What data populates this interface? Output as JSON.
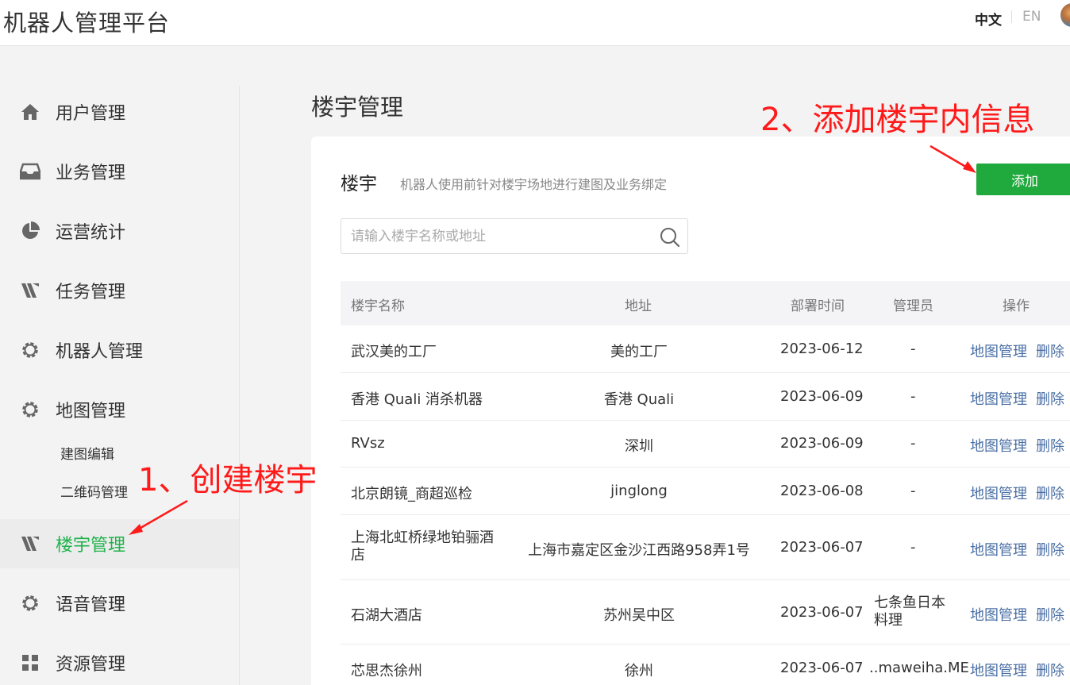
{
  "header": {
    "title": "机器人管理平台",
    "lang_zh": "中文",
    "lang_en": "EN"
  },
  "sidebar": {
    "items": [
      {
        "label": "用户管理",
        "icon": "home-icon"
      },
      {
        "label": "业务管理",
        "icon": "inbox-icon"
      },
      {
        "label": "运营统计",
        "icon": "pie-chart-icon"
      },
      {
        "label": "任务管理",
        "icon": "task-icon"
      },
      {
        "label": "机器人管理",
        "icon": "gear-icon"
      },
      {
        "label": "地图管理",
        "icon": "gear-icon"
      },
      {
        "label": "楼宇管理",
        "icon": "building-icon"
      },
      {
        "label": "语音管理",
        "icon": "gear-icon"
      },
      {
        "label": "资源管理",
        "icon": "grid-icon"
      }
    ],
    "subitems": [
      "建图编辑",
      "二维码管理"
    ],
    "active_color": "#20b24a"
  },
  "main": {
    "page_title": "楼宇管理",
    "card_title": "楼宇",
    "card_desc": "机器人使用前针对楼宇场地进行建图及业务绑定",
    "add_label": "添加",
    "search_placeholder": "请输入楼宇名称或地址",
    "columns": [
      "楼宇名称",
      "地址",
      "部署时间",
      "管理员",
      "操作"
    ],
    "rows": [
      {
        "name": "武汉美的工厂",
        "address": "美的工厂",
        "date": "2023-06-12",
        "admin": "-",
        "map": "地图管理",
        "del": "删除"
      },
      {
        "name": "香港 Quali 消杀机器",
        "address": "香港 Quali",
        "date": "2023-06-09",
        "admin": "-",
        "map": "地图管理",
        "del": "删除"
      },
      {
        "name": "RVsz",
        "address": "深圳",
        "date": "2023-06-09",
        "admin": "-",
        "map": "地图管理",
        "del": "删除"
      },
      {
        "name": "北京朗镜_商超巡检",
        "address": "jinglong",
        "date": "2023-06-08",
        "admin": "-",
        "map": "地图管理",
        "del": "删除"
      },
      {
        "name": "上海北虹桥绿地铂骊酒店",
        "address": "上海市嘉定区金沙江西路958弄1号",
        "date": "2023-06-07",
        "admin": "-",
        "map": "地图管理",
        "del": "删除"
      },
      {
        "name": "石湖大酒店",
        "address": "苏州吴中区",
        "date": "2023-06-07",
        "admin": "七条鱼日本料理",
        "map": "地图管理",
        "del": "删除"
      },
      {
        "name": "芯思杰徐州",
        "address": "徐州",
        "date": "2023-06-07",
        "admin": "..maweiha.ME",
        "map": "地图管理",
        "del": "删除"
      }
    ],
    "accent": "#20a93c",
    "link_color": "#4a6fa5"
  },
  "annotations": {
    "step1": "1、创建楼宇",
    "step2": "2、添加楼宇内信息",
    "color": "#ff1a1a"
  }
}
